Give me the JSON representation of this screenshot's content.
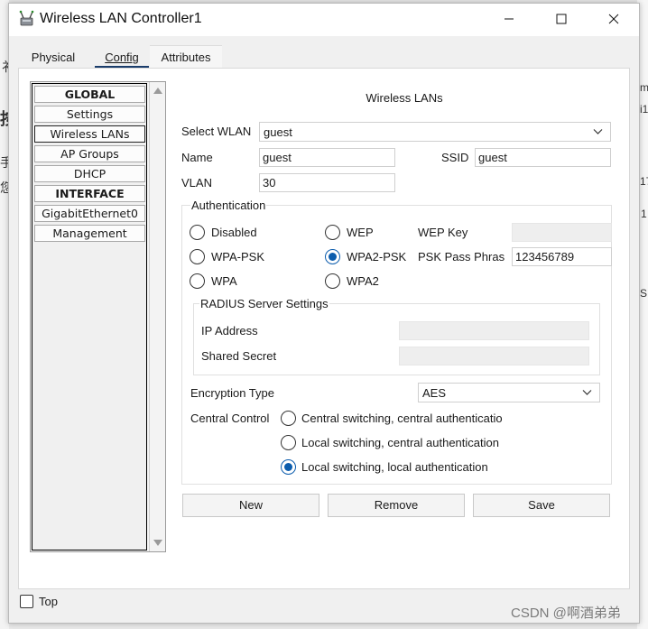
{
  "window": {
    "title": "Wireless LAN Controller1"
  },
  "tabs": [
    {
      "label": "Physical"
    },
    {
      "label": "Config"
    },
    {
      "label": "Attributes"
    }
  ],
  "nav": {
    "items": [
      {
        "label": "GLOBAL"
      },
      {
        "label": "Settings"
      },
      {
        "label": "Wireless LANs"
      },
      {
        "label": "AP Groups"
      },
      {
        "label": "DHCP"
      },
      {
        "label": "INTERFACE"
      },
      {
        "label": "GigabitEthernet0"
      },
      {
        "label": "Management"
      }
    ]
  },
  "panel": {
    "title": "Wireless LANs",
    "select_wlan": {
      "label": "Select WLAN",
      "value": "guest"
    },
    "name": {
      "label": "Name",
      "value": "guest"
    },
    "ssid": {
      "label": "SSID",
      "value": "guest"
    },
    "vlan": {
      "label": "VLAN",
      "value": "30"
    },
    "authentication": {
      "legend": "Authentication",
      "options": {
        "disabled": "Disabled",
        "wep": "WEP",
        "wpa_psk": "WPA-PSK",
        "wpa2_psk": "WPA2-PSK",
        "wpa": "WPA",
        "wpa2": "WPA2"
      },
      "selected": "WPA2-PSK",
      "wep_key": {
        "label": "WEP Key",
        "value": ""
      },
      "psk_pass_phrase": {
        "label": "PSK Pass Phras",
        "value": "123456789"
      },
      "radius": {
        "legend": "RADIUS Server Settings",
        "ip_address_label": "IP Address",
        "shared_secret_label": "Shared Secret"
      }
    },
    "encryption": {
      "label": "Encryption Type",
      "value": "AES"
    },
    "central_control": {
      "label": "Central Control",
      "options": [
        "Central switching, central authenticatio",
        "Local switching, central authentication",
        "Local switching, local authentication"
      ],
      "selected": "Local switching, local authentication"
    },
    "buttons": {
      "new": "New",
      "remove": "Remove",
      "save": "Save"
    }
  },
  "footer": {
    "top_label": "Top"
  },
  "watermark": "CSDN @啊酒弟弟",
  "background_glyphs": [
    "衤",
    "按",
    "手",
    "您",
    "m",
    "i1",
    "17",
    "1",
    "S"
  ],
  "colors": {
    "radio_selected": "#0b5cad",
    "tab_underline": "#1a3d6b"
  }
}
